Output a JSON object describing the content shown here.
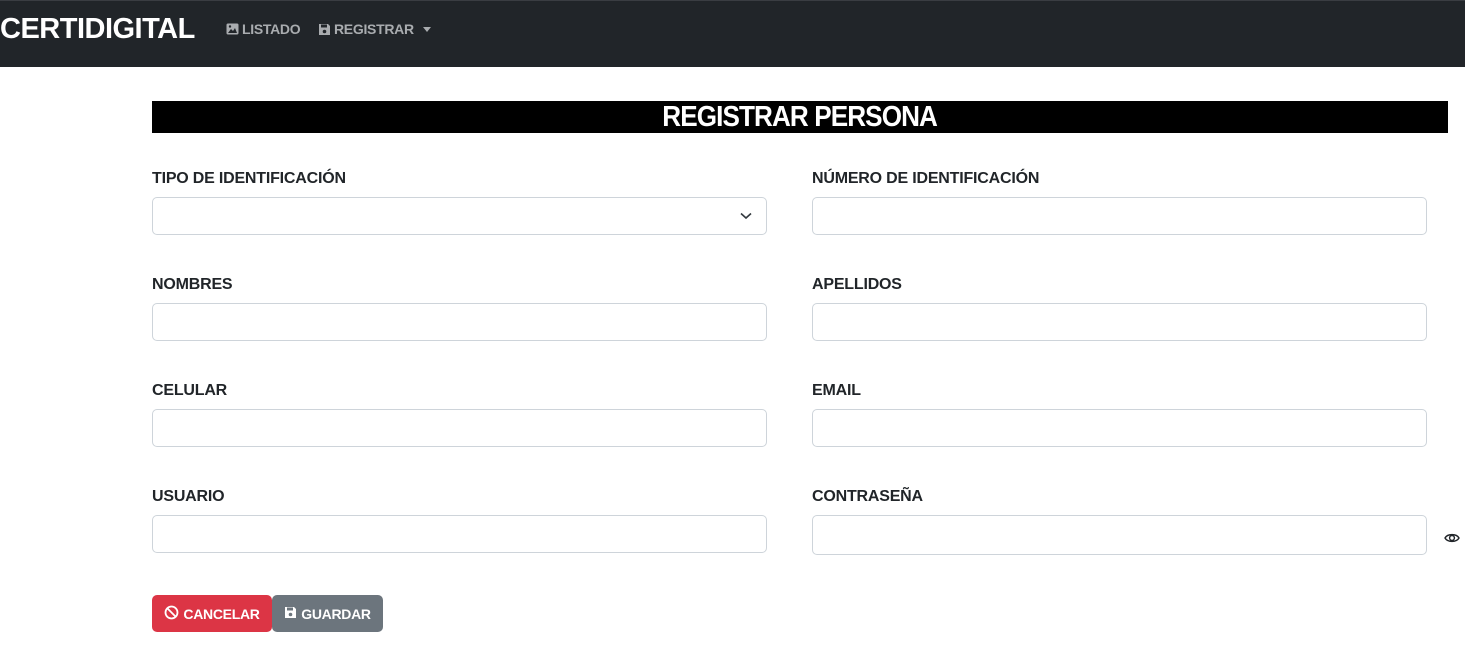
{
  "navbar": {
    "brand": "CERTIDIGITAL",
    "links": [
      {
        "label": "LISTADO",
        "icon": "image-icon"
      },
      {
        "label": "REGISTRAR",
        "icon": "save-icon",
        "dropdown": true
      }
    ]
  },
  "form": {
    "title": "REGISTRAR PERSONA",
    "fields": {
      "tipo": {
        "label": "TIPO DE IDENTIFICACIÓN",
        "value": ""
      },
      "numero": {
        "label": "NÚMERO DE IDENTIFICACIÓN",
        "value": ""
      },
      "nombres": {
        "label": "NOMBRES",
        "value": ""
      },
      "apellidos": {
        "label": "APELLIDOS",
        "value": ""
      },
      "celular": {
        "label": "CELULAR",
        "value": ""
      },
      "email": {
        "label": "EMAIL",
        "value": ""
      },
      "usuario": {
        "label": "USUARIO",
        "value": ""
      },
      "contrasena": {
        "label": "CONTRASEÑA",
        "value": ""
      }
    },
    "buttons": {
      "cancel": "CANCELAR",
      "save": "GUARDAR"
    }
  },
  "colors": {
    "navbar_bg": "#212529",
    "title_bg": "#000000",
    "cancel_bg": "#dc3545",
    "save_bg": "#6c757d"
  }
}
